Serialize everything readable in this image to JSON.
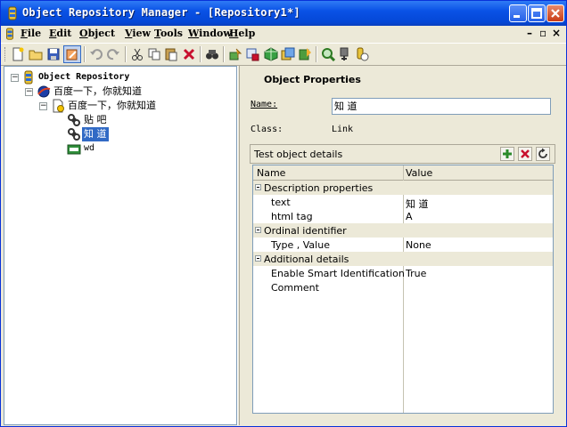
{
  "window": {
    "title": "Object Repository Manager - [Repository1*]"
  },
  "menu": {
    "items": [
      {
        "key": "F",
        "rest": "ile"
      },
      {
        "key": "E",
        "rest": "dit"
      },
      {
        "key": "O",
        "rest": "bject"
      },
      {
        "key": "V",
        "rest": "iew"
      },
      {
        "key": "T",
        "rest": "ools"
      },
      {
        "key": "W",
        "rest": "indow"
      },
      {
        "key": "H",
        "rest": "elp"
      }
    ]
  },
  "tree": {
    "root": "Object Repository",
    "page_1": "百度一下，你就知道",
    "page_2": "百度一下，你就知道",
    "link_tieba": "贴 吧",
    "link_zhidao": "知 道",
    "edit_wd": "wd"
  },
  "props": {
    "title": "Object Properties",
    "name_label": "Name:",
    "name_value": "知 道",
    "class_label": "Class:",
    "class_value": "Link",
    "details_title": "Test object details",
    "col_name": "Name",
    "col_value": "Value",
    "rows": [
      {
        "kind": "cat",
        "name": "Description properties",
        "value": ""
      },
      {
        "kind": "prop",
        "name": "text",
        "value": "知 道"
      },
      {
        "kind": "prop",
        "name": "html tag",
        "value": "A"
      },
      {
        "kind": "cat",
        "name": "Ordinal identifier",
        "value": ""
      },
      {
        "kind": "prop",
        "name": "Type , Value",
        "value": "None"
      },
      {
        "kind": "cat",
        "name": "Additional details",
        "value": ""
      },
      {
        "kind": "prop",
        "name": "Enable Smart Identification",
        "value": "True"
      },
      {
        "kind": "prop",
        "name": "Comment",
        "value": ""
      }
    ]
  },
  "colors": {
    "title_blue": "#0a52e6",
    "selection": "#316ac5",
    "add_green": "#2a8a2a",
    "delete_red": "#c8102e"
  }
}
